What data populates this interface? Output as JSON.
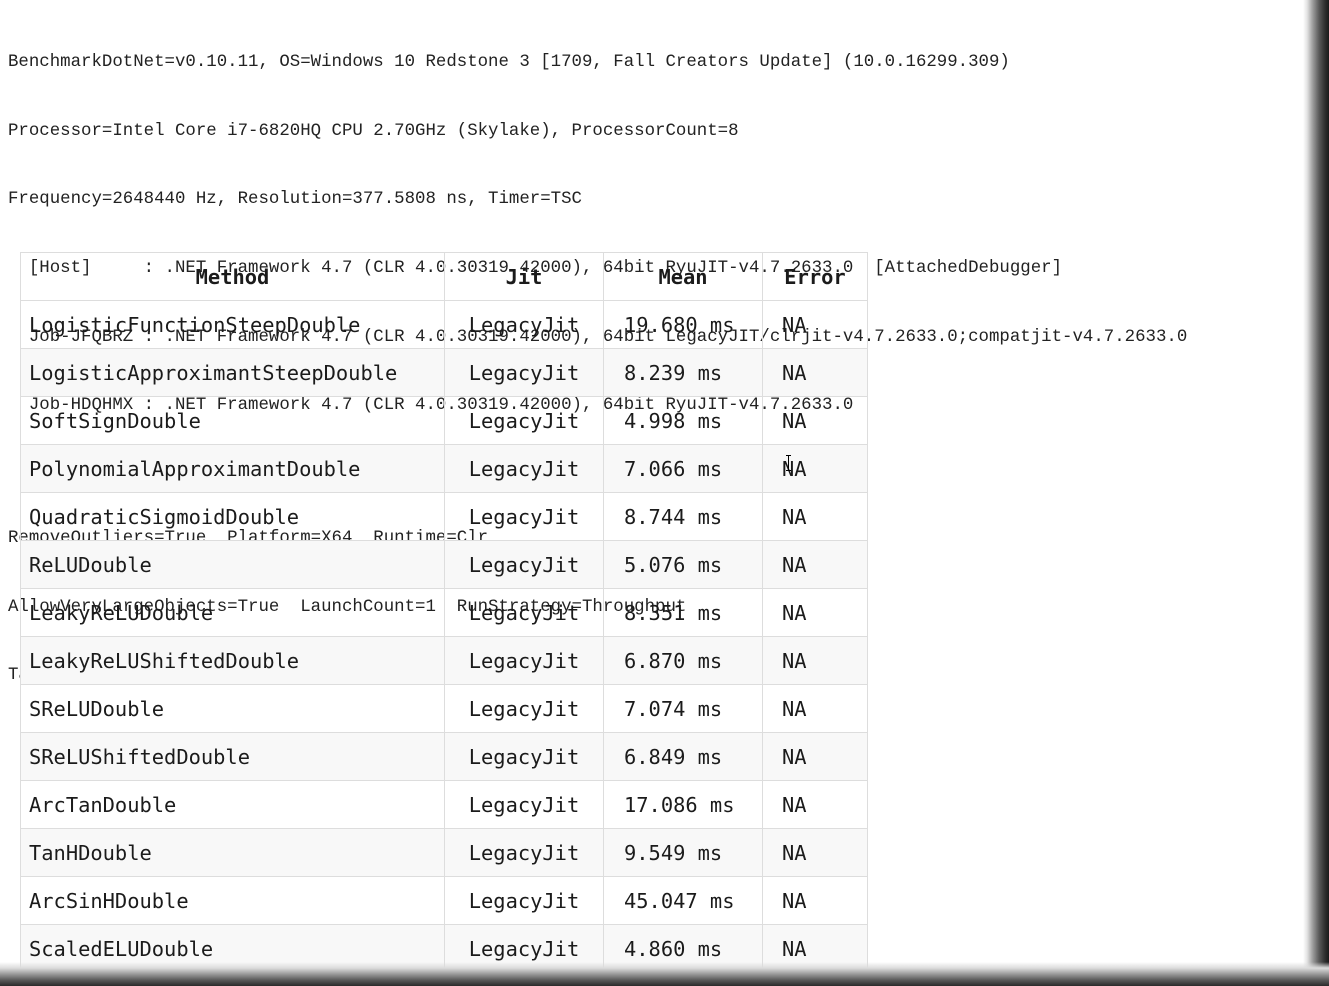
{
  "env_info": {
    "lines": [
      "BenchmarkDotNet=v0.10.11, OS=Windows 10 Redstone 3 [1709, Fall Creators Update] (10.0.16299.309)",
      "Processor=Intel Core i7-6820HQ CPU 2.70GHz (Skylake), ProcessorCount=8",
      "Frequency=2648440 Hz, Resolution=377.5808 ns, Timer=TSC",
      "  [Host]     : .NET Framework 4.7 (CLR 4.0.30319.42000), 64bit RyuJIT-v4.7.2633.0  [AttachedDebugger]",
      "  Job-JFQBRZ : .NET Framework 4.7 (CLR 4.0.30319.42000), 64bit LegacyJIT/clrjit-v4.7.2633.0;compatjit-v4.7.2633.0",
      "  Job-HDQHMX : .NET Framework 4.7 (CLR 4.0.30319.42000), 64bit RyuJIT-v4.7.2633.0"
    ],
    "job_lines": [
      "RemoveOutliers=True  Platform=X64  Runtime=Clr",
      "AllowVeryLargeObjects=True  LaunchCount=1  RunStrategy=Throughput",
      "TargetCount=1  WarmupCount=1"
    ]
  },
  "table": {
    "headers": {
      "method": "Method",
      "jit": "Jit",
      "mean": "Mean",
      "error": "Error"
    },
    "rows": [
      {
        "method": "LogisticFunctionSteepDouble",
        "jit": "LegacyJit",
        "mean": "19.680 ms",
        "error": "NA"
      },
      {
        "method": "LogisticApproximantSteepDouble",
        "jit": "LegacyJit",
        "mean": "8.239 ms",
        "error": "NA"
      },
      {
        "method": "SoftSignDouble",
        "jit": "LegacyJit",
        "mean": "4.998 ms",
        "error": "NA"
      },
      {
        "method": "PolynomialApproximantDouble",
        "jit": "LegacyJit",
        "mean": "7.066 ms",
        "error": "NA"
      },
      {
        "method": "QuadraticSigmoidDouble",
        "jit": "LegacyJit",
        "mean": "8.744 ms",
        "error": "NA"
      },
      {
        "method": "ReLUDouble",
        "jit": "LegacyJit",
        "mean": "5.076 ms",
        "error": "NA"
      },
      {
        "method": "LeakyReLUDouble",
        "jit": "LegacyJit",
        "mean": "8.351 ms",
        "error": "NA"
      },
      {
        "method": "LeakyReLUShiftedDouble",
        "jit": "LegacyJit",
        "mean": "6.870 ms",
        "error": "NA"
      },
      {
        "method": "SReLUDouble",
        "jit": "LegacyJit",
        "mean": "7.074 ms",
        "error": "NA"
      },
      {
        "method": "SReLUShiftedDouble",
        "jit": "LegacyJit",
        "mean": "6.849 ms",
        "error": "NA"
      },
      {
        "method": "ArcTanDouble",
        "jit": "LegacyJit",
        "mean": "17.086 ms",
        "error": "NA"
      },
      {
        "method": "TanHDouble",
        "jit": "LegacyJit",
        "mean": "9.549 ms",
        "error": "NA"
      },
      {
        "method": "ArcSinHDouble",
        "jit": "LegacyJit",
        "mean": "45.047 ms",
        "error": "NA"
      },
      {
        "method": "ScaledELUDouble",
        "jit": "LegacyJit",
        "mean": "4.860 ms",
        "error": "NA"
      }
    ]
  },
  "icons": {
    "cursor": "text-cursor-icon"
  }
}
